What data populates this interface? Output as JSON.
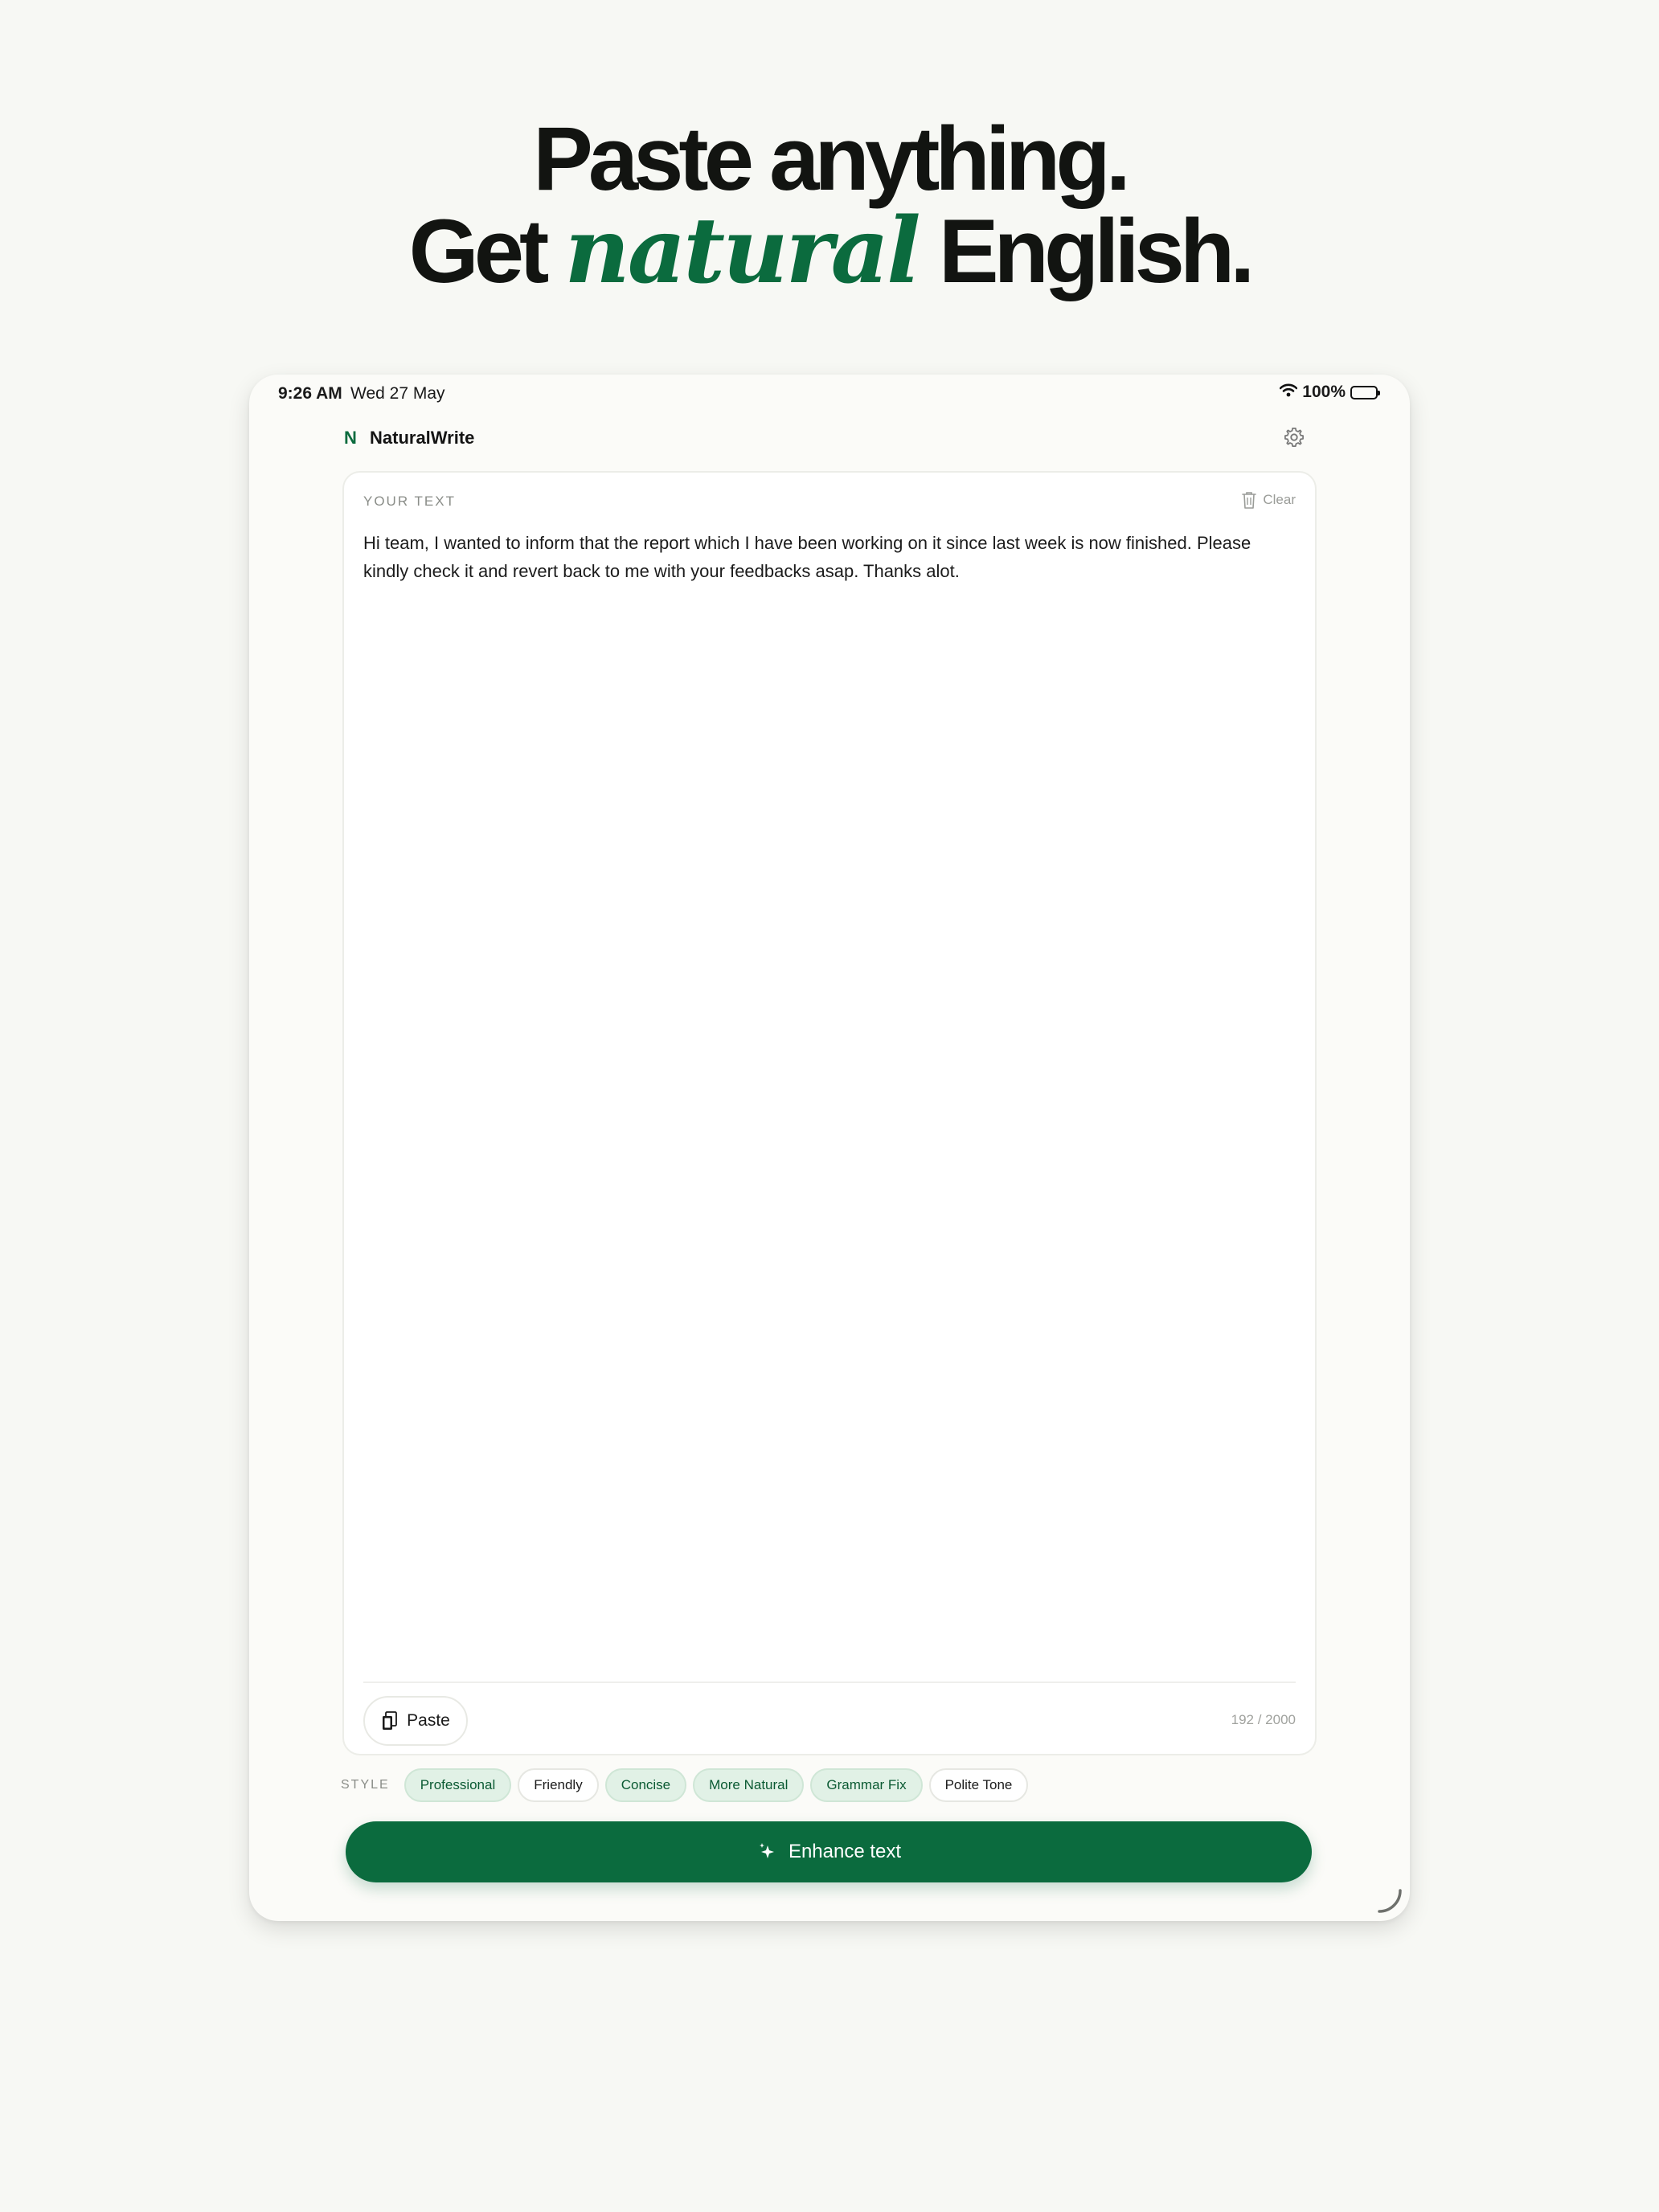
{
  "headline": {
    "line1": "Paste anything.",
    "line2_pre": "Get ",
    "line2_accent": "natural",
    "line2_post": " English."
  },
  "status_bar": {
    "time": "9:26 AM",
    "date": "Wed 27 May",
    "battery_text": "100%",
    "icons": [
      "wifi-icon",
      "battery-icon"
    ]
  },
  "app": {
    "logo_mark": "N",
    "name": "NaturalWrite",
    "settings_icon": "gear-icon"
  },
  "editor": {
    "label": "YOUR TEXT",
    "clear_label": "Clear",
    "clear_icon": "trash-icon",
    "text": "Hi team, I wanted to inform that the report which I have been working on it since last week is now finished. Please kindly check it and revert back to me with your feedbacks asap. Thanks alot.",
    "paste_label": "Paste",
    "paste_icon": "clipboard-icon",
    "counter": "192 / 2000"
  },
  "style": {
    "label": "STYLE",
    "chips": [
      {
        "label": "Professional",
        "selected": true
      },
      {
        "label": "Friendly",
        "selected": false
      },
      {
        "label": "Concise",
        "selected": true
      },
      {
        "label": "More Natural",
        "selected": true
      },
      {
        "label": "Grammar Fix",
        "selected": true
      },
      {
        "label": "Polite Tone",
        "selected": false
      }
    ]
  },
  "action": {
    "label": "Enhance text",
    "icon": "sparkle-icon"
  },
  "colors": {
    "accent": "#0b6b3e",
    "background": "#f7f8f4",
    "chip_selected_bg": "#e1f1e6"
  }
}
